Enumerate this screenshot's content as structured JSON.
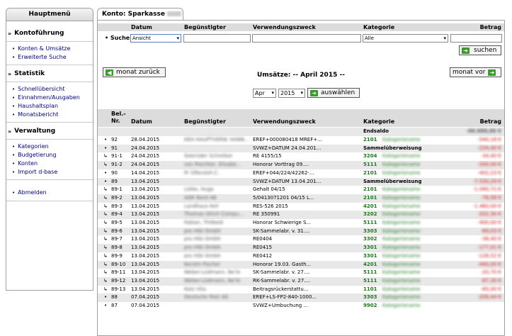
{
  "sidebar": {
    "title": "Hauptmenü",
    "sections": [
      {
        "title": "Kontoführung",
        "items": [
          "Konten & Umsätze",
          "Erweiterte Suche"
        ]
      },
      {
        "title": "Statistik",
        "items": [
          "Schnellübersicht",
          "Einnahmen/Ausgaben",
          "Haushaltsplan",
          "Monatsbericht"
        ]
      },
      {
        "title": "Verwaltung",
        "items": [
          "Kategorien",
          "Budgetierung",
          "Konten",
          "Import d-base"
        ]
      },
      {
        "title": "",
        "items": [
          "Abmelden"
        ]
      }
    ]
  },
  "tab": {
    "label": "Konto: Sparkasse"
  },
  "filter_header": {
    "datum": "Datum",
    "beguenstigter": "Begünstigter",
    "zweck": "Verwendungszweck",
    "kategorie": "Kategorie",
    "betrag": "Betrag"
  },
  "search": {
    "label": "Suche",
    "datum_value": "Ansicht",
    "kategorie_value": "Alle",
    "button": "suchen"
  },
  "nav": {
    "prev": "monat zurück",
    "next": "monat vor",
    "title": "Umsätze: -- April 2015 --",
    "month": "Apr",
    "year": "2015",
    "select_button": "auswählen"
  },
  "table": {
    "headers": {
      "nr": "Bel.-Nr.",
      "datum": "Datum",
      "beguenstigter": "Begünstigter",
      "zweck": "Verwendungszweck",
      "kategorie": "Kategorie",
      "betrag": "Betrag"
    },
    "endsaldo_label": "Endsaldo",
    "rows": [
      {
        "nr": "92",
        "datum": "28.04.2015",
        "beg": "KEH HAUPTVERW. HANN...",
        "zweck": "EREF+000080418 MREF+...",
        "kat": "2101",
        "betrag": "-540,18 €"
      },
      {
        "nr": "91",
        "datum": "24.04.2015",
        "beg": "",
        "zweck": "SVWZ+DATUM 24.04.201...",
        "kat": "Sammelüberweisung",
        "betrag": "-234,40 €"
      },
      {
        "nr": "91-1",
        "datum": "24.04.2015",
        "beg": "Gebrüder Schreiber",
        "zweck": "RE 4155/15",
        "kat": "3204",
        "betrag": "-34,40 €"
      },
      {
        "nr": "91-2",
        "datum": "24.04.2015",
        "beg": "von Riechter, Elisabe...",
        "zweck": "Honorar Vorttrag 09....",
        "kat": "5111",
        "betrag": "-200,00 €"
      },
      {
        "nr": "90",
        "datum": "14.04.2015",
        "beg": "Pr Ülfersleh.C.",
        "zweck": "EREF+044/224/42262-...",
        "kat": "2101",
        "betrag": "-402,23 €"
      },
      {
        "nr": "89",
        "datum": "13.04.2015",
        "beg": "",
        "zweck": "SVWZ+DATUM 13.04.201...",
        "kat": "Sammelüberweisung",
        "betrag": "-7.530,24 €"
      },
      {
        "nr": "89-1",
        "datum": "13.04.2015",
        "beg": "Lütke, Hugo",
        "zweck": "Gehalt 04/15",
        "kat": "2101",
        "betrag": "-1.090,72 €"
      },
      {
        "nr": "89-2",
        "datum": "13.04.2015",
        "beg": "AOK Nord AB",
        "zweck": "5/0413071201 04/15 L...",
        "kat": "2101",
        "betrag": "-78,58 €"
      },
      {
        "nr": "89-3",
        "datum": "13.04.2015",
        "beg": "Landhaus Keil",
        "zweck": "RES-526 2015",
        "kat": "4201",
        "betrag": "-1.460,00 €"
      },
      {
        "nr": "89-4",
        "datum": "13.04.2015",
        "beg": "Thomas Ulrich Compu...",
        "zweck": "RE 350991",
        "kat": "3202",
        "betrag": "-202,30 €"
      },
      {
        "nr": "89-5",
        "datum": "13.04.2015",
        "beg": "Fabian, Thilbeld",
        "zweck": "Honorar Schwierige S...",
        "kat": "5111",
        "betrag": "-400,00 €"
      },
      {
        "nr": "89-6",
        "datum": "13.04.2015",
        "beg": "pro Hibi GmbH",
        "zweck": "SK-Sammelabr. v. 31....",
        "kat": "3303",
        "betrag": "-69,03 €"
      },
      {
        "nr": "89-7",
        "datum": "13.04.2015",
        "beg": "pro Hibi GmbH",
        "zweck": "RE0404",
        "kat": "3302",
        "betrag": "-38,40 €"
      },
      {
        "nr": "89-8",
        "datum": "13.04.2015",
        "beg": "pro Hibi GmbH",
        "zweck": "RE0415",
        "kat": "3301",
        "betrag": "-177,01 €"
      },
      {
        "nr": "89-9",
        "datum": "13.04.2015",
        "beg": "pro Hibi GmbH",
        "zweck": "RE0412",
        "kat": "3301",
        "betrag": "-128,52 €"
      },
      {
        "nr": "89-10",
        "datum": "13.04.2015",
        "beg": "Kerstin Fischer",
        "zweck": "Honorar 19.03. Gasth...",
        "kat": "4201",
        "betrag": "-440,00 €"
      },
      {
        "nr": "89-11",
        "datum": "13.04.2015",
        "beg": "Weber-Lüdmann, Ne'le",
        "zweck": "SK-Sammelabr. v. 27....",
        "kat": "5111",
        "betrag": "-20,70 €"
      },
      {
        "nr": "89-12",
        "datum": "13.04.2015",
        "beg": "Weber-Lüdmann, Ne'le",
        "zweck": "RK-Sammelabr. v. 27....",
        "kat": "5111",
        "betrag": "-67,30 €"
      },
      {
        "nr": "89-13",
        "datum": "13.04.2015",
        "beg": "Kotz Vita",
        "zweck": "Beitragsrückerstattu...",
        "kat": "1101",
        "betrag": "-65,00 €"
      },
      {
        "nr": "88",
        "datum": "07.04.2015",
        "beg": "Deutsche Post AG",
        "zweck": "EREF+LS-FP2-840-1000...",
        "kat": "3303",
        "betrag": "-209,44 €"
      },
      {
        "nr": "87",
        "datum": "07.04.2015",
        "beg": "",
        "zweck": "SVWZ+Umbuchung ...",
        "kat": "9902",
        "betrag": ""
      }
    ]
  }
}
